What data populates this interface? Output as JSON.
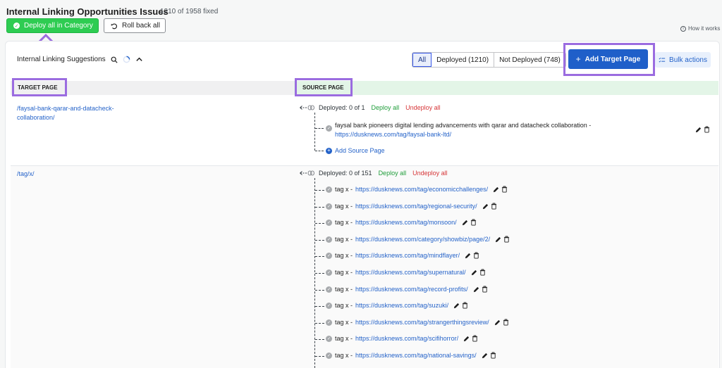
{
  "header": {
    "title": "Internal Linking Opportunities Issues",
    "fixed_count": "1210 of 1958 fixed",
    "deploy_category_label": "Deploy all in Category",
    "rollback_label": "Roll back all",
    "how_it_works": "How it works"
  },
  "toolbar": {
    "section_label": "Internal Linking Suggestions",
    "filters": [
      "All",
      "Deployed (1210)",
      "Not Deployed (748)"
    ],
    "add_target_label": "Add Target Page",
    "bulk_actions_label": "Bulk actions"
  },
  "table": {
    "col_target": "TARGET PAGE",
    "col_source": "SOURCE PAGE"
  },
  "rows": [
    {
      "target_line1": "/faysal-bank-qarar-and-datacheck-",
      "target_line2": "collaboration/",
      "deployed": "Deployed: 0 of 1",
      "deploy_all": "Deploy all",
      "undeploy_all": "Undeploy all",
      "source_text": "faysal bank pioneers digital lending advancements with qarar and datacheck collaboration -",
      "source_url": "https://dusknews.com/tag/faysal-bank-ltd/",
      "add_source": "Add Source Page"
    },
    {
      "target": "/tag/x/",
      "deployed": "Deployed: 0 of 151",
      "deploy_all": "Deploy all",
      "undeploy_all": "Undeploy all",
      "anchor": "tag x -",
      "sources": [
        "https://dusknews.com/tag/economicchallenges/",
        "https://dusknews.com/tag/regional-security/",
        "https://dusknews.com/tag/monsoon/",
        "https://dusknews.com/category/showbiz/page/2/",
        "https://dusknews.com/tag/mindflayer/",
        "https://dusknews.com/tag/supernatural/",
        "https://dusknews.com/tag/record-profits/",
        "https://dusknews.com/tag/suzuki/",
        "https://dusknews.com/tag/strangerthingsreview/",
        "https://dusknews.com/tag/scifihorror/",
        "https://dusknews.com/tag/national-savings/"
      ]
    }
  ],
  "colors": {
    "deploy_green": "#2ecc52",
    "primary_blue": "#1f5fc9",
    "highlight_purple": "#9b6ce0",
    "link_blue": "#2563c9"
  }
}
